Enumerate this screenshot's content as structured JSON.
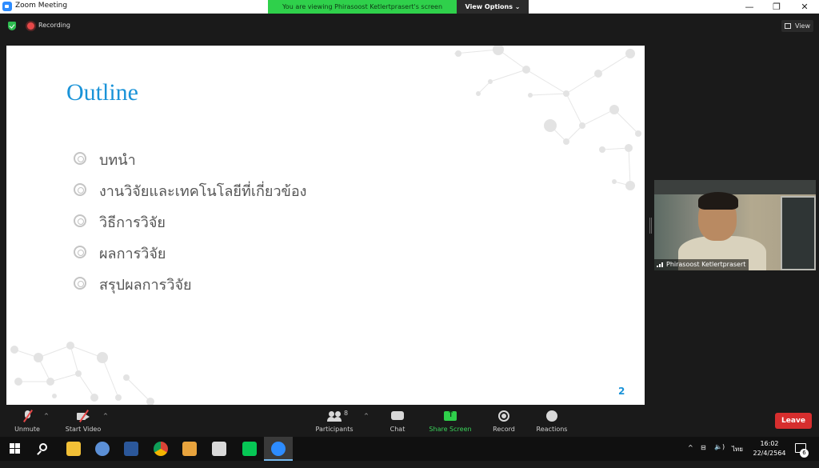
{
  "window": {
    "title": "Zoom Meeting",
    "share_banner": "You are viewing Phirasoost Ketlertprasert's screen",
    "view_options": "View Options ⌄",
    "minimize": "—",
    "restore": "❐",
    "close": "✕"
  },
  "top_bar": {
    "recording_label": "Recording",
    "view_label": "View"
  },
  "slide": {
    "title": "Outline",
    "bullets": [
      "บทนำ",
      "งานวิจัยและเทคโนโลยีที่เกี่ยวข้อง",
      "วิธีการวิจัย",
      "ผลการวิจัย",
      "สรุปผลการวิจัย"
    ],
    "page_number": "2",
    "accent_color": "#1a93d8"
  },
  "video": {
    "participant_name": "Phirasoost Ketlertprasert"
  },
  "toolbar": {
    "unmute": "Unmute",
    "start_video": "Start Video",
    "participants": "Participants",
    "participants_count": "8",
    "chat": "Chat",
    "share_screen": "Share Screen",
    "record": "Record",
    "reactions": "Reactions",
    "leave": "Leave",
    "caret": "^"
  },
  "taskbar": {
    "apps": [
      "start-icon",
      "search-icon",
      "file-explorer-icon",
      "snipping-icon",
      "word-icon",
      "chrome-icon",
      "media-player-icon",
      "calculator-icon",
      "line-icon",
      "zoom-icon"
    ],
    "tray_up": "^",
    "tray_network": "⊟",
    "tray_volume": "🔈)",
    "language": "ไทย",
    "time": "16:02",
    "date": "22/4/2564",
    "notification_count": "6"
  },
  "colors": {
    "zoom_blue": "#2d8cff",
    "share_green": "#2fd04b",
    "leave_red": "#d62e2e"
  }
}
